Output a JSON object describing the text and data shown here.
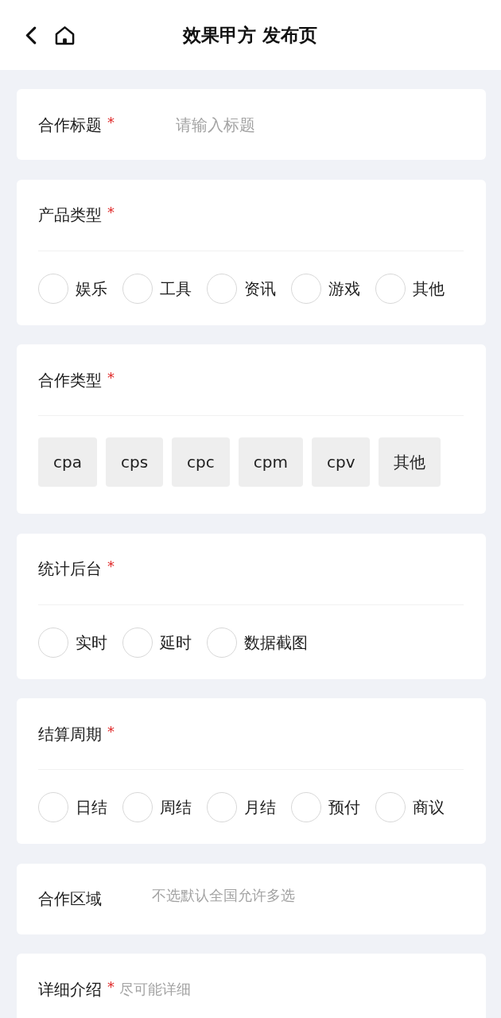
{
  "header": {
    "title": "效果甲方 发布页"
  },
  "sections": [
    {
      "kind": "input",
      "label": "合作标题",
      "required_mark": "*",
      "placeholder": "请输入标题"
    },
    {
      "kind": "radio",
      "label": "产品类型",
      "required_mark": "*",
      "options": [
        {
          "label": "娱乐",
          "selected": false
        },
        {
          "label": "工具",
          "selected": false
        },
        {
          "label": "资讯",
          "selected": false
        },
        {
          "label": "游戏",
          "selected": false
        },
        {
          "label": "其他",
          "selected": false
        }
      ]
    },
    {
      "kind": "chips",
      "label": "合作类型",
      "required_mark": "*",
      "options": [
        {
          "label": "cpa",
          "selected": false
        },
        {
          "label": "cps",
          "selected": false
        },
        {
          "label": "cpc",
          "selected": false
        },
        {
          "label": "cpm",
          "selected": false
        },
        {
          "label": "cpv",
          "selected": false
        },
        {
          "label": "其他",
          "selected": false
        }
      ]
    },
    {
      "kind": "radio",
      "label": "统计后台",
      "required_mark": "*",
      "options": [
        {
          "label": "实时",
          "selected": false
        },
        {
          "label": "延时",
          "selected": false
        },
        {
          "label": "数据截图",
          "selected": false
        }
      ]
    },
    {
      "kind": "radio",
      "label": "结算周期",
      "required_mark": "*",
      "options": [
        {
          "label": "日结",
          "selected": false
        },
        {
          "label": "周结",
          "selected": false
        },
        {
          "label": "月结",
          "selected": false
        },
        {
          "label": "预付",
          "selected": false
        },
        {
          "label": "商议",
          "selected": false
        }
      ]
    },
    {
      "kind": "picker",
      "label": "合作区域",
      "hint": "不选默认全国允许多选"
    },
    {
      "kind": "textarea",
      "label": "详细介绍",
      "required_mark": "*",
      "hint": "尽可能详细"
    }
  ]
}
